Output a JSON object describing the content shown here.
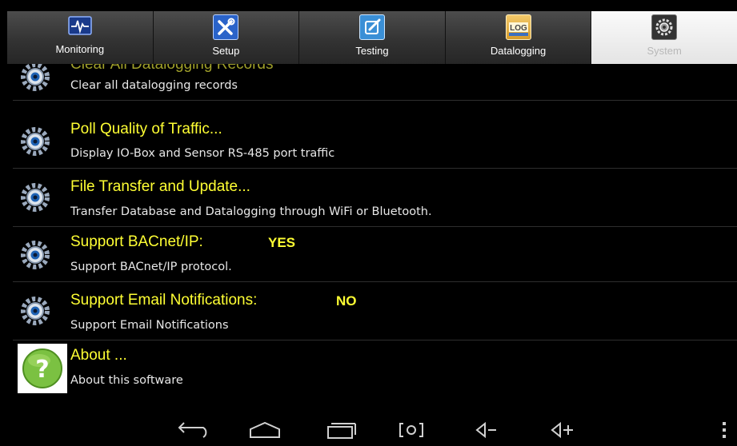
{
  "tabs": [
    {
      "label": "Monitoring",
      "icon": "monitoring-icon"
    },
    {
      "label": "Setup",
      "icon": "setup-tools-icon"
    },
    {
      "label": "Testing",
      "icon": "testing-edit-icon"
    },
    {
      "label": "Datalogging",
      "icon": "datalogging-log-icon"
    },
    {
      "label": "System",
      "icon": "system-gears-icon",
      "active": true
    }
  ],
  "items": [
    {
      "title": "Clear All Datalogging Records",
      "desc": "Clear all datalogging records",
      "icon": "gear-icon"
    },
    {
      "title": "Poll Quality of Traffic...",
      "desc": "Display IO-Box and Sensor RS-485 port traffic",
      "icon": "gear-icon"
    },
    {
      "title": "File Transfer and Update...",
      "desc": "Transfer Database and Datalogging through WiFi or Bluetooth.",
      "icon": "gear-icon"
    },
    {
      "title": "Support BACnet/IP:",
      "value": "YES",
      "desc": "Support BACnet/IP protocol.",
      "icon": "gear-icon"
    },
    {
      "title": "Support Email Notifications:",
      "value": "NO",
      "desc": "Support Email Notifications",
      "icon": "gear-icon"
    },
    {
      "title": "About ...",
      "desc": "About this software",
      "icon": "help-question-icon"
    }
  ],
  "navbar": {
    "icons": [
      "back-icon",
      "home-icon",
      "recent-apps-icon",
      "screenshot-icon",
      "volume-down-icon",
      "volume-up-icon",
      "overflow-menu-icon"
    ]
  },
  "colors": {
    "title": "#ffff33",
    "desc": "#e8e8e8",
    "background": "#000000"
  }
}
